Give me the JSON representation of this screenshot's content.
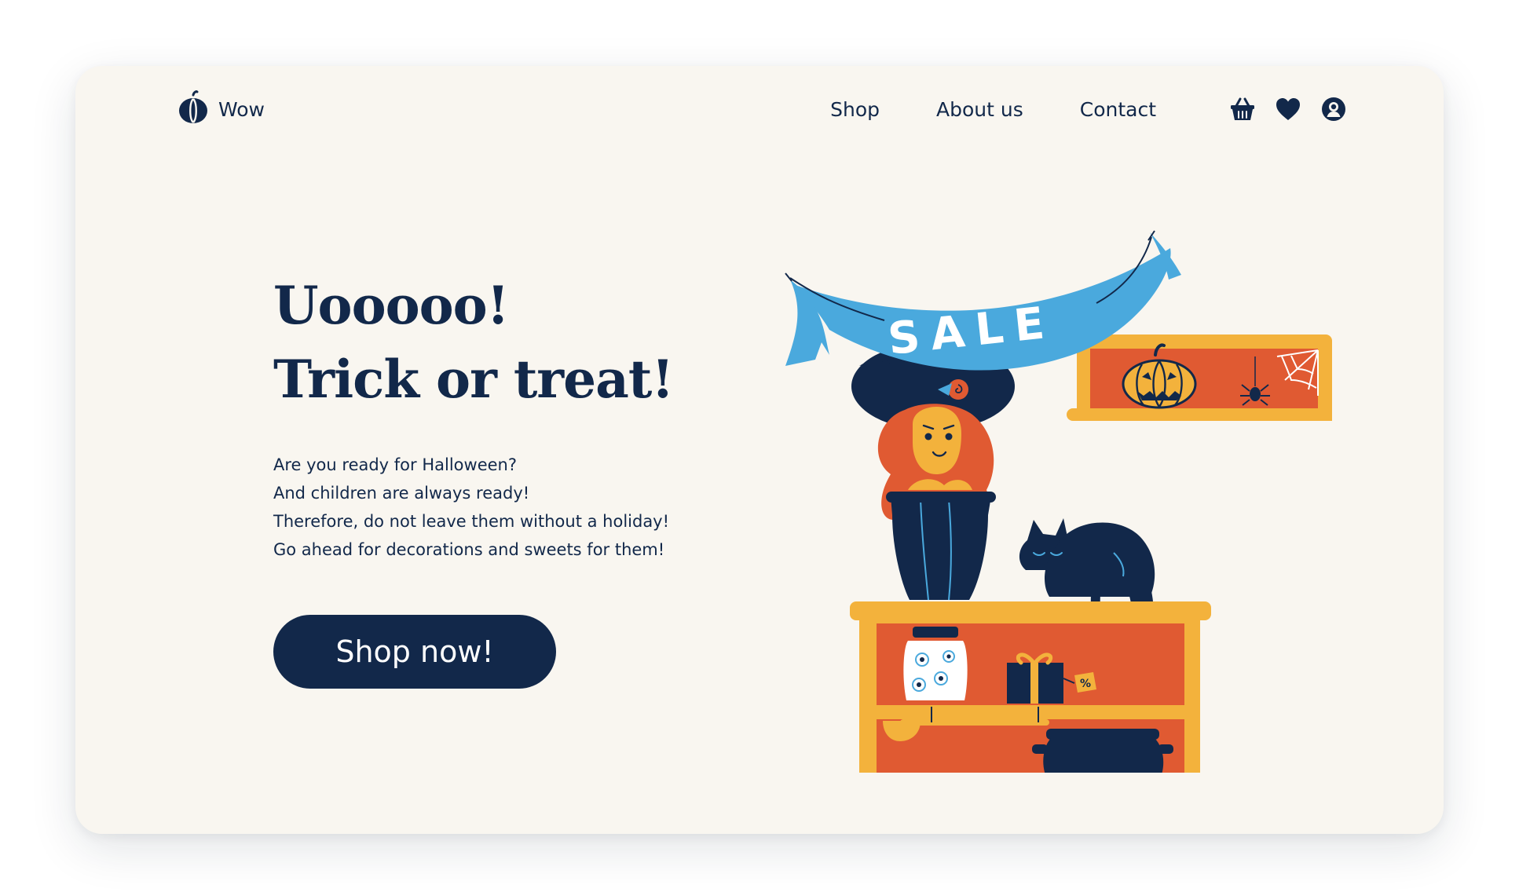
{
  "header": {
    "brand_name": "Wow",
    "nav": [
      {
        "label": "Shop"
      },
      {
        "label": "About us"
      },
      {
        "label": "Contact"
      }
    ],
    "icons": [
      "basket-icon",
      "heart-icon",
      "user-icon"
    ]
  },
  "hero": {
    "headline_line1": "Uooooo!",
    "headline_line2": "Trick or treat!",
    "body_lines": [
      "Are you ready for Halloween?",
      "And children are always ready!",
      "Therefore, do not leave them without a holiday!",
      "Go ahead for decorations and sweets for them!"
    ],
    "cta_label": "Shop now!"
  },
  "illustration": {
    "banner_text": "SALE",
    "colors": {
      "navy": "#12284a",
      "orange": "#e05a32",
      "yellow": "#f3b23c",
      "blue": "#4aa9dd",
      "cream": "#f9f6f0"
    }
  }
}
